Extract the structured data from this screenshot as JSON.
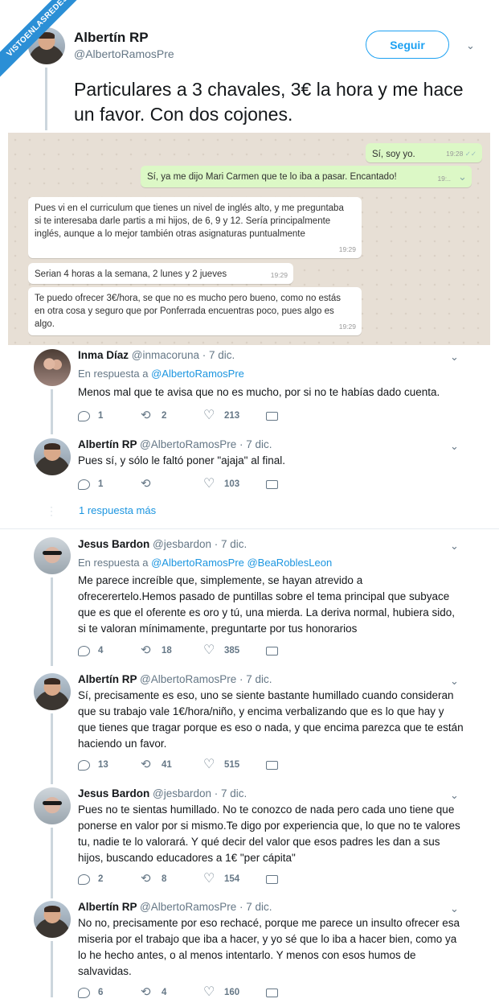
{
  "watermark": "VISTOENLASREDES",
  "main": {
    "name": "Albertín RP",
    "handle": "@AlbertoRamosPre",
    "follow_label": "Seguir",
    "text": "Particulares a 3 chavales, 3€ la hora y me hace un favor. Con dos cojones."
  },
  "chat": {
    "m1": {
      "text": "Sí, soy yo.",
      "time": "19:28"
    },
    "m2": {
      "text": "Sí, ya me dijo Mari Carmen que te lo iba a pasar. Encantado!",
      "time": "19:.."
    },
    "m3": {
      "text": "Pues vi en el curriculum que tienes un nivel de inglés alto, y me preguntaba si te interesaba darle partis a mi hijos, de 6, 9 y 12. Sería principalmente inglés, aunque a lo mejor también otras asignaturas puntualmente",
      "time": "19:29"
    },
    "m4": {
      "text": "Serian 4 horas a la semana, 2 lunes y 2 jueves",
      "time": "19:29"
    },
    "m5": {
      "text": "Te puedo ofrecer 3€/hora, se que no es mucho pero bueno, como no estás en otra cosa y seguro que por Ponferrada encuentras poco, pues algo es algo.",
      "time": "19:29"
    }
  },
  "replies": [
    {
      "name": "Inma Díaz",
      "handle": "@inmacoruna · 7 dic.",
      "reply_prefix": "En respuesta a",
      "reply_to": "@AlbertoRamosPre",
      "text": "Menos mal que te avisa que no es mucho, por si no te habías dado cuenta.",
      "replies": "1",
      "retweets": "2",
      "likes": "213"
    },
    {
      "name": "Albertín RP",
      "handle": "@AlbertoRamosPre · 7 dic.",
      "text": "Pues sí, y sólo le faltó poner \"ajaja\" al final.",
      "replies": "1",
      "retweets": "",
      "likes": "103"
    },
    {
      "name": "Jesus Bardon",
      "handle": "@jesbardon · 7 dic.",
      "reply_prefix": "En respuesta a",
      "reply_to": "@AlbertoRamosPre @BeaRoblesLeon",
      "text": "Me parece increíble que, simplemente, se hayan atrevido a ofrecerertelo.Hemos pasado de puntillas sobre el tema principal que subyace que es que el oferente es oro y tú, una mierda. La deriva normal, hubiera sido, si te valoran mínimamente, preguntarte por tus honorarios",
      "replies": "4",
      "retweets": "18",
      "likes": "385"
    },
    {
      "name": "Albertín RP",
      "handle": "@AlbertoRamosPre · 7 dic.",
      "text": "Sí, precisamente es eso, uno se siente bastante humillado cuando consideran que su trabajo vale 1€/hora/niño, y encima verbalizando que es lo que hay y que tienes que tragar porque es eso o nada, y que encima parezca que te están haciendo un favor.",
      "replies": "13",
      "retweets": "41",
      "likes": "515"
    },
    {
      "name": "Jesus Bardon",
      "handle": "@jesbardon · 7 dic.",
      "text": "Pues no te sientas humillado. No te conozco de nada pero cada uno tiene que ponerse en valor por si mismo.Te digo por experiencia que, lo que no te valores tu, nadie te lo valorará. Y qué decir del valor que esos padres les dan a sus hijos, buscando educadores a 1€ \"per cápita\"",
      "replies": "2",
      "retweets": "8",
      "likes": "154"
    },
    {
      "name": "Albertín RP",
      "handle": "@AlbertoRamosPre · 7 dic.",
      "text": "No no, precisamente por eso rechacé, porque me parece un insulto ofrecer esa miseria por el trabajo que iba a hacer, y yo sé que lo iba a hacer bien, como ya lo he hecho antes, o al menos intentarlo. Y menos con esos humos de salvavidas.",
      "replies": "6",
      "retweets": "4",
      "likes": "160"
    }
  ],
  "more_replies": "1 respuesta más"
}
